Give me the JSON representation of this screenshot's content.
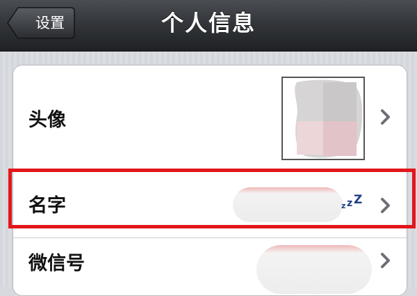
{
  "header": {
    "back_label": "设置",
    "title": "个人信息"
  },
  "profile": {
    "rows": [
      {
        "label": "头像",
        "value_type": "avatar-image",
        "icon": "chevron-right-icon"
      },
      {
        "label": "名字",
        "value_type": "redacted-text",
        "icon": "chevron-right-icon",
        "status_icon": "sleep-zzz-icon"
      },
      {
        "label": "微信号",
        "value_type": "redacted-text",
        "icon": "chevron-right-icon"
      }
    ]
  },
  "colors": {
    "topbar": "#2c2f33",
    "highlight": "#e2161b",
    "accent_zzz": "#1f3f86"
  }
}
